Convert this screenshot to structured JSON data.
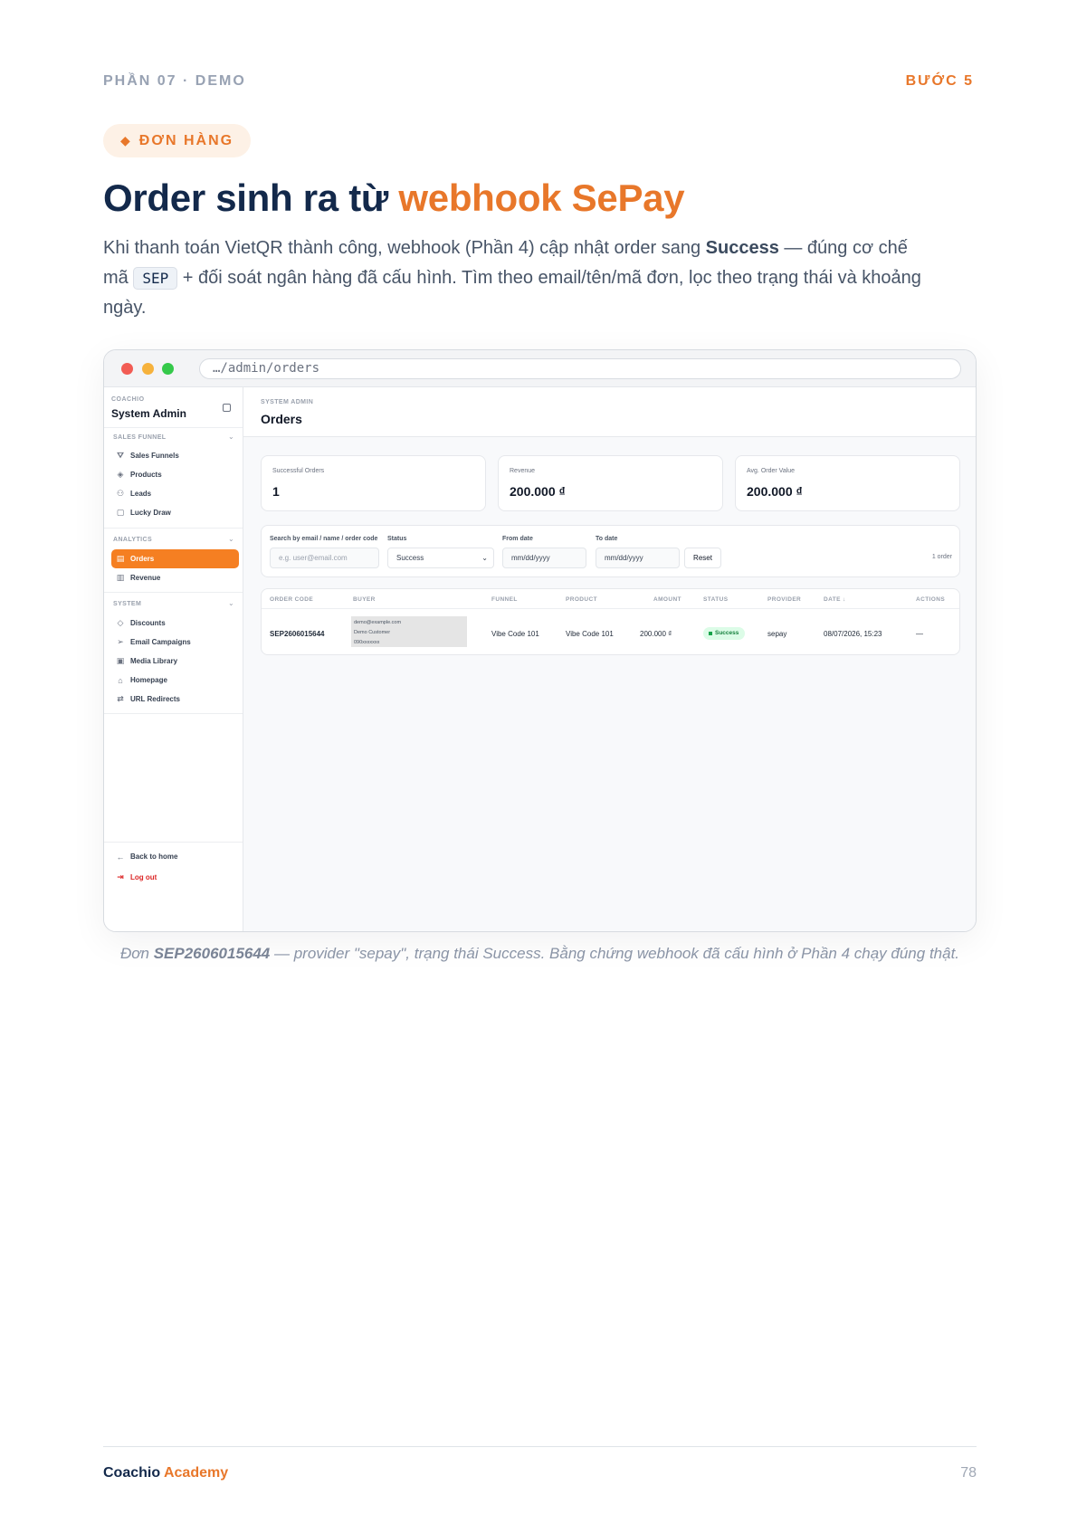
{
  "header": {
    "section": "PHẦN 07 · DEMO",
    "step": "BƯỚC 5"
  },
  "pill": {
    "icon": "diamond-icon",
    "glyph": "◆",
    "label": "ĐƠN HÀNG"
  },
  "title": {
    "main": "Order sinh ra từ ",
    "accent": "webhook SePay"
  },
  "lead": {
    "p1": "Khi thanh toán VietQR thành công, webhook (Phần 4) cập nhật order sang ",
    "bold": "Success",
    "p2": " — đúng cơ chế mã ",
    "code": "SEP",
    "p3": " + đối soát ngân hàng đã cấu hình. Tìm theo email/tên/mã đơn, lọc theo trạng thái và khoảng ngày."
  },
  "browser": {
    "url": "…/admin/orders"
  },
  "sidebar": {
    "brand_small": "COACHIO",
    "brand_name": "System Admin",
    "sections": [
      {
        "label": "SALES FUNNEL",
        "items": [
          {
            "label": "Sales Funnels",
            "icon": "funnel-icon",
            "glyph": "⛛"
          },
          {
            "label": "Products",
            "icon": "box-icon",
            "glyph": "◈"
          },
          {
            "label": "Leads",
            "icon": "users-icon",
            "glyph": "⚇"
          },
          {
            "label": "Lucky Draw",
            "icon": "square-icon",
            "glyph": "▢"
          }
        ]
      },
      {
        "label": "ANALYTICS",
        "items": [
          {
            "label": "Orders",
            "icon": "receipt-icon",
            "glyph": "▤",
            "active": true
          },
          {
            "label": "Revenue",
            "icon": "bar-chart-icon",
            "glyph": "▥"
          }
        ]
      },
      {
        "label": "SYSTEM",
        "items": [
          {
            "label": "Discounts",
            "icon": "tag-icon",
            "glyph": "◇"
          },
          {
            "label": "Email Campaigns",
            "icon": "send-icon",
            "glyph": "➢"
          },
          {
            "label": "Media Library",
            "icon": "image-icon",
            "glyph": "▣"
          },
          {
            "label": "Homepage",
            "icon": "home-icon",
            "glyph": "⌂"
          },
          {
            "label": "URL Redirects",
            "icon": "redirect-icon",
            "glyph": "⇄"
          }
        ]
      }
    ],
    "back_label": "Back to home",
    "back_glyph": "←",
    "logout_label": "Log out",
    "logout_glyph": "⇥"
  },
  "page": {
    "kicker": "SYSTEM ADMIN",
    "title": "Orders"
  },
  "stats": [
    {
      "label": "Successful Orders",
      "value": "1"
    },
    {
      "label": "Revenue",
      "value": "200.000 ₫"
    },
    {
      "label": "Avg. Order Value",
      "value": "200.000 ₫"
    }
  ],
  "filters": {
    "search_label": "Search by email / name / order code",
    "search_placeholder": "e.g. user@email.com",
    "status_label": "Status",
    "status_value": "Success",
    "from_label": "From date",
    "from_placeholder": "mm/dd/yyyy",
    "to_label": "To date",
    "to_placeholder": "mm/dd/yyyy",
    "reset_label": "Reset",
    "count": "1 order"
  },
  "table": {
    "headers": [
      "ORDER CODE",
      "BUYER",
      "FUNNEL",
      "PRODUCT",
      "AMOUNT",
      "STATUS",
      "PROVIDER",
      "DATE ↓",
      "ACTIONS"
    ],
    "rows": [
      {
        "order_code": "SEP2606015644",
        "buyer_email": "demo@example.com",
        "buyer_name": "Demo Customer",
        "buyer_phone": "090xxxxxxx",
        "funnel": "Vibe Code 101",
        "product": "Vibe Code 101",
        "amount": "200.000 ₫",
        "status": "Success",
        "provider": "sepay",
        "date": "08/07/2026, 15:23",
        "actions": "—"
      }
    ]
  },
  "caption": {
    "p1": "Đơn ",
    "bold": "SEP2606015644",
    "p2": " — provider \"sepay\", trạng thái Success. Bằng chứng webhook đã cấu hình ở Phần 4 chạy đúng thật."
  },
  "footer": {
    "brand": "Coachio",
    "brand_accent": " Academy",
    "page_number": "78"
  }
}
